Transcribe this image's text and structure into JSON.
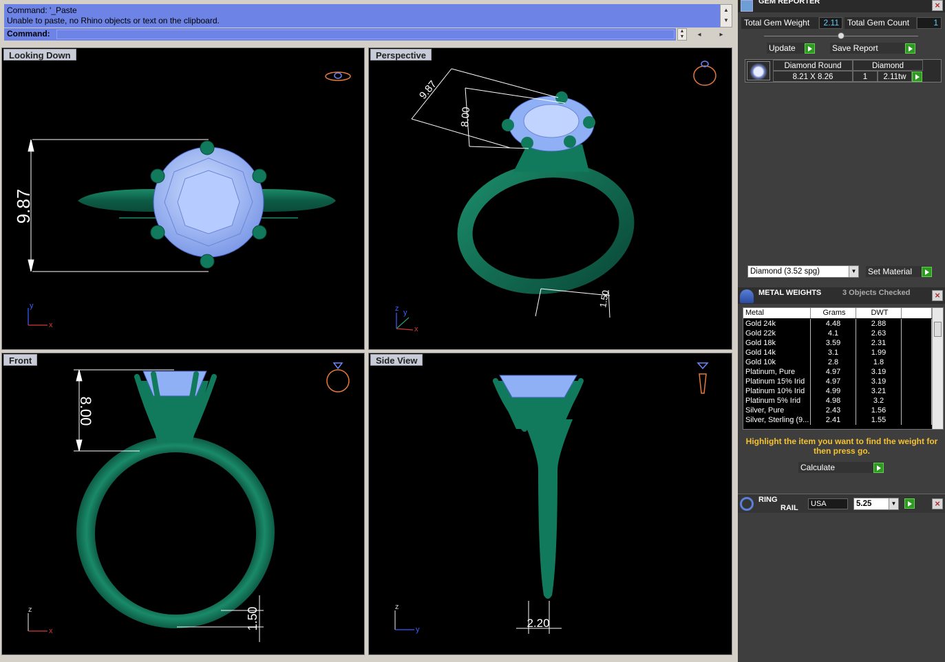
{
  "command": {
    "history": [
      "Command: '_Paste",
      "Unable to paste, no Rhino objects or text on the clipboard."
    ],
    "prompt": "Command:",
    "input": ""
  },
  "viewports": [
    {
      "title": "Looking Down",
      "dimension": "9.87",
      "axes": [
        "y",
        "x"
      ]
    },
    {
      "title": "Perspective",
      "dimensions": [
        "9.87",
        "8.00",
        "1.50"
      ],
      "axes": [
        "z",
        "y",
        "x"
      ]
    },
    {
      "title": "Front",
      "dimensions": [
        "8.00",
        "1.50"
      ],
      "axes": [
        "z",
        "x"
      ]
    },
    {
      "title": "Side View",
      "dimension": "2.20",
      "axes": [
        "z",
        "y"
      ]
    }
  ],
  "gem_reporter": {
    "title": "GEM REPORTER",
    "total_weight_label": "Total Gem Weight",
    "total_weight": "2.11",
    "total_count_label": "Total Gem Count",
    "total_count": "1",
    "update_label": "Update",
    "save_label": "Save Report",
    "gem": {
      "shape": "Diamond Round",
      "size": "8.21 X 8.26",
      "material": "Diamond",
      "count": "1",
      "weight": "2.11tw"
    },
    "material_select": "Diamond    (3.52 spg)",
    "set_material_label": "Set Material"
  },
  "metal_weights": {
    "title": "METAL WEIGHTS",
    "status": "3 Objects Checked",
    "columns": [
      "Metal",
      "Grams",
      "DWT"
    ],
    "rows": [
      [
        "Gold 24k",
        "4.48",
        "2.88"
      ],
      [
        "Gold 22k",
        "4.1",
        "2.63"
      ],
      [
        "Gold 18k",
        "3.59",
        "2.31"
      ],
      [
        "Gold 14k",
        "3.1",
        "1.99"
      ],
      [
        "Gold 10k",
        "2.8",
        "1.8"
      ],
      [
        "Platinum, Pure",
        "4.97",
        "3.19"
      ],
      [
        "Platinum 15% Irid",
        "4.97",
        "3.19"
      ],
      [
        "Platinum 10% Irid",
        "4.99",
        "3.21"
      ],
      [
        "Platinum 5% Irid",
        "4.98",
        "3.2"
      ],
      [
        "Silver, Pure",
        "2.43",
        "1.56"
      ],
      [
        "Silver, Sterling (9...",
        "2.41",
        "1.55"
      ]
    ],
    "hint": "Highlight the item you want to find the weight for then press go.",
    "calculate_label": "Calculate"
  },
  "ring_rail": {
    "title_line1": "RING",
    "title_line2": "RAIL",
    "standard": "USA",
    "size": "5.25"
  },
  "colors": {
    "command_bg": "#6d84e6",
    "viewport_bg": "#000000",
    "metal": "#0f6e55",
    "gem": "#8fb0f5",
    "panel_bg": "#3e3e3e",
    "accent_go": "#2e9a22",
    "hint_text": "#f4c233"
  }
}
